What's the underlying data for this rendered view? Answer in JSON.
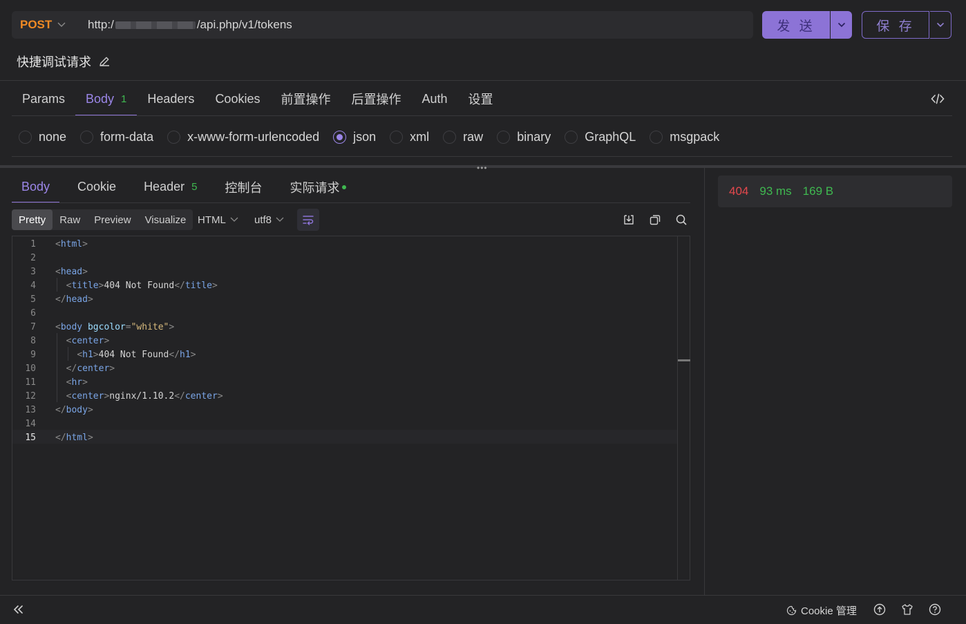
{
  "request": {
    "method": "POST",
    "url_prefix": "http:/",
    "url_suffix": "/api.php/v1/tokens",
    "send_label": "发 送",
    "save_label": "保 存",
    "name": "快捷调试请求"
  },
  "req_tabs": [
    {
      "label": "Params"
    },
    {
      "label": "Body",
      "badge": "1"
    },
    {
      "label": "Headers"
    },
    {
      "label": "Cookies"
    },
    {
      "label": "前置操作"
    },
    {
      "label": "后置操作"
    },
    {
      "label": "Auth"
    },
    {
      "label": "设置"
    }
  ],
  "body_types": [
    "none",
    "form-data",
    "x-www-form-urlencoded",
    "json",
    "xml",
    "raw",
    "binary",
    "GraphQL",
    "msgpack"
  ],
  "body_type_selected": "json",
  "res_tabs": [
    {
      "label": "Body"
    },
    {
      "label": "Cookie"
    },
    {
      "label": "Header",
      "badge": "5"
    },
    {
      "label": "控制台"
    },
    {
      "label": "实际请求"
    }
  ],
  "view_modes": [
    "Pretty",
    "Raw",
    "Preview",
    "Visualize"
  ],
  "format": "HTML",
  "encoding": "utf8",
  "line_numbers": [
    "1",
    "2",
    "3",
    "4",
    "5",
    "6",
    "7",
    "8",
    "9",
    "10",
    "11",
    "12",
    "13",
    "14",
    "15"
  ],
  "code": {
    "t_html": "html",
    "t_head": "head",
    "t_title": "title",
    "title_text": "404 Not Found",
    "t_body": "body",
    "attr_bgcolor": "bgcolor",
    "attr_value": "\"white\"",
    "t_center": "center",
    "t_h1": "h1",
    "h1_text": "404 Not Found",
    "t_hr": "hr",
    "server_text": "nginx/1.10.2"
  },
  "status": {
    "code": "404",
    "time": "93 ms",
    "size": "169 B",
    "code_color": "#e5484d",
    "ok_color": "#3fb950"
  },
  "footer": {
    "cookie_manager": "Cookie 管理"
  }
}
